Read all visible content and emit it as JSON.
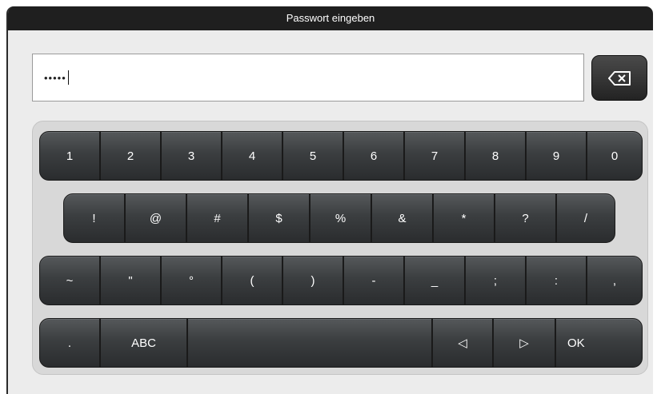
{
  "title": "Passwort eingeben",
  "password_mask": "•••••",
  "backspace_icon": "backspace-icon",
  "rows": [
    [
      "1",
      "2",
      "3",
      "4",
      "5",
      "6",
      "7",
      "8",
      "9",
      "0"
    ],
    [
      "!",
      "@",
      "#",
      "$",
      "%",
      "&",
      "*",
      "?",
      "/"
    ],
    [
      "~",
      "\"",
      "°",
      "(",
      ")",
      "-",
      "_",
      ";",
      ":",
      ","
    ],
    [
      ".",
      "ABC",
      "",
      "◁",
      "▷",
      "OK"
    ]
  ]
}
